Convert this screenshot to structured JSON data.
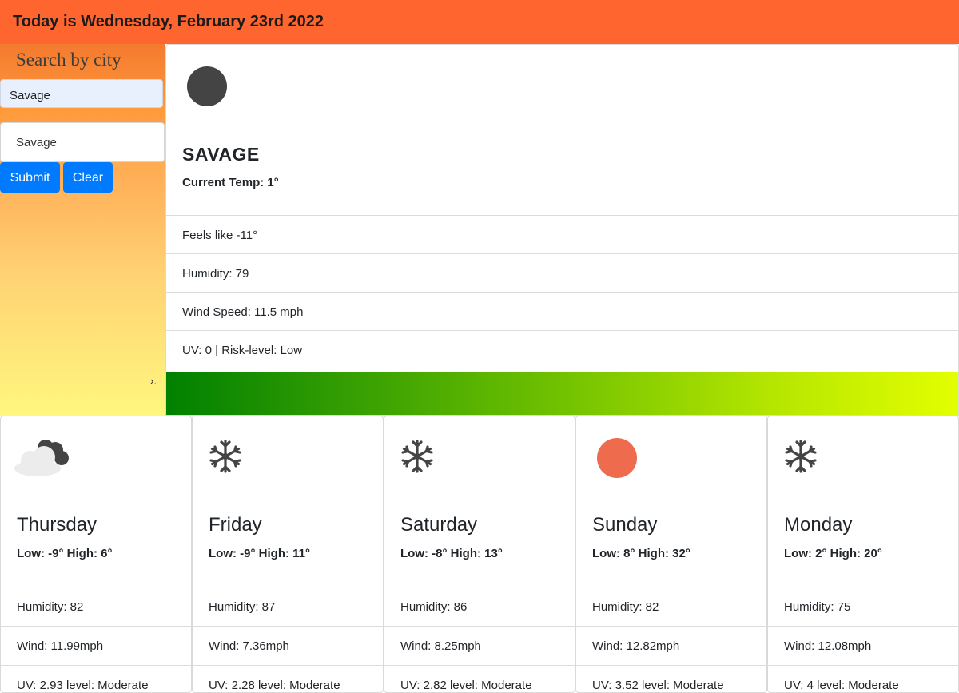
{
  "header": {
    "title": "Today is Wednesday, February 23rd 2022"
  },
  "sidebar": {
    "heading": "Search by city",
    "selected_city": "Savage",
    "input_value": "Savage",
    "submit_label": "Submit",
    "clear_label": "Clear",
    "handle_glyph": "›."
  },
  "current": {
    "icon": "moon-icon",
    "city": "SAVAGE",
    "current_temp": "Current Temp: 1°",
    "feels_like": "Feels like -11°",
    "humidity": "Humidity: 79",
    "wind_speed": "Wind Speed: 11.5 mph",
    "uv": "UV: 0 | Risk-level: Low"
  },
  "forecast": [
    {
      "icon": "cloudy-night-icon",
      "day": "Thursday",
      "low_high": "Low: -9° High: 6°",
      "humidity": "Humidity: 82",
      "wind": "Wind: 11.99mph",
      "uv": "UV: 2.93 level: Moderate"
    },
    {
      "icon": "snowflake-icon",
      "day": "Friday",
      "low_high": "Low: -9° High: 11°",
      "humidity": "Humidity: 87",
      "wind": "Wind: 7.36mph",
      "uv": "UV: 2.28 level: Moderate"
    },
    {
      "icon": "snowflake-icon",
      "day": "Saturday",
      "low_high": "Low: -8° High: 13°",
      "humidity": "Humidity: 86",
      "wind": "Wind: 8.25mph",
      "uv": "UV: 2.82 level: Moderate"
    },
    {
      "icon": "sun-icon",
      "day": "Sunday",
      "low_high": "Low: 8° High: 32°",
      "humidity": "Humidity: 82",
      "wind": "Wind: 12.82mph",
      "uv": "UV: 3.52 level: Moderate"
    },
    {
      "icon": "snowflake-icon",
      "day": "Monday",
      "low_high": "Low: 2° High: 20°",
      "humidity": "Humidity: 75",
      "wind": "Wind: 12.08mph",
      "uv": "UV: 4 level: Moderate"
    }
  ],
  "colors": {
    "header_bg": "#ff652f",
    "button_bg": "#007bff",
    "sun_icon": "#ee6b4d",
    "moon_icon": "#444444"
  }
}
